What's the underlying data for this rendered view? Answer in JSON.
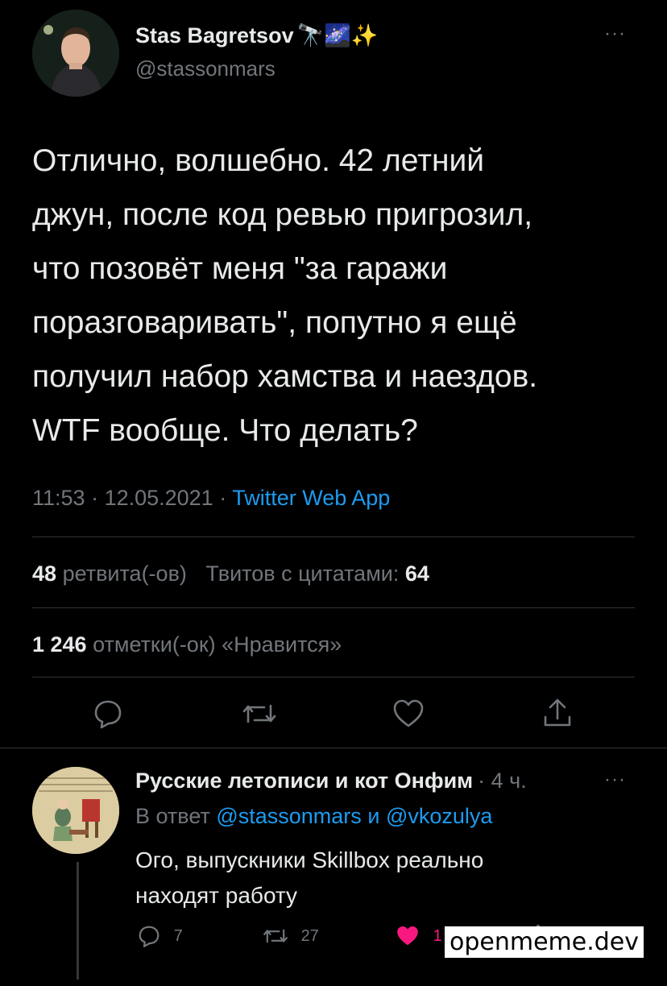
{
  "tweet": {
    "author_name": "Stas Bagretsov",
    "author_emoji": "🔭🌌✨",
    "handle": "@stassonmars",
    "text_lines": [
      "Отлично, волшебно. 42 летний",
      "джун, после код ревью пригрозил,",
      "что позовёт меня \"за гаражи",
      "поразговаривать\", попутно я ещё",
      "получил набор хамства и наездов.",
      "WTF вообще. Что делать?"
    ],
    "time": "11:53",
    "date": "12.05.2021",
    "source": "Twitter Web App",
    "retweets_count": "48",
    "retweets_label": "ретвита(-ов)",
    "quotes_label": "Твитов с цитатами:",
    "quotes_count": "64",
    "likes_count": "1 246",
    "likes_label": "отметки(-ок) «Нравится»",
    "more": "···"
  },
  "reply": {
    "author_name": "Русские летописи и кот Онфим",
    "time": "· 4 ч.",
    "more": "···",
    "reply_to_prefix": "В ответ",
    "reply_to_user1": "@stassonmars",
    "reply_to_and": "и",
    "reply_to_user2": "@vkozulya",
    "text_line1": "Ого, выпускники Skillbox реально",
    "text_line2": "находят работу",
    "reply_count": "7",
    "retweet_count": "27",
    "like_count": "1 254"
  },
  "watermark": "openmeme.dev",
  "colors": {
    "accent": "#1d9bf0",
    "like": "#f91880",
    "muted": "#71767b"
  }
}
